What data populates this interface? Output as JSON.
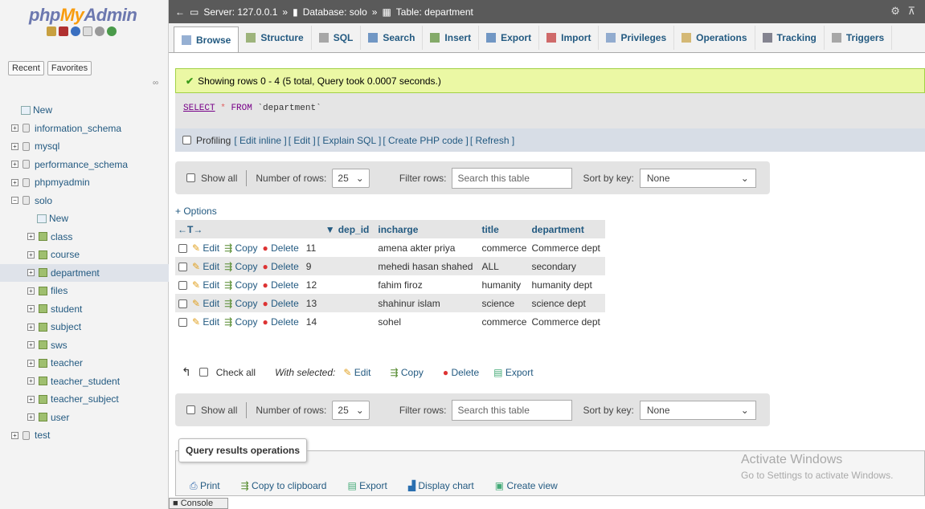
{
  "nav": {
    "logo_php": "php",
    "logo_my": "My",
    "logo_admin": "Admin",
    "recent": "Recent",
    "favorites": "Favorites",
    "tree": [
      {
        "label": "New",
        "level": 0,
        "kind": "new"
      },
      {
        "label": "information_schema",
        "level": 0,
        "kind": "db"
      },
      {
        "label": "mysql",
        "level": 0,
        "kind": "db"
      },
      {
        "label": "performance_schema",
        "level": 0,
        "kind": "db"
      },
      {
        "label": "phpmyadmin",
        "level": 0,
        "kind": "db"
      },
      {
        "label": "solo",
        "level": 0,
        "kind": "db-open"
      },
      {
        "label": "New",
        "level": 1,
        "kind": "new"
      },
      {
        "label": "class",
        "level": 1,
        "kind": "table"
      },
      {
        "label": "course",
        "level": 1,
        "kind": "table"
      },
      {
        "label": "department",
        "level": 1,
        "kind": "table",
        "selected": true
      },
      {
        "label": "files",
        "level": 1,
        "kind": "table"
      },
      {
        "label": "student",
        "level": 1,
        "kind": "table"
      },
      {
        "label": "subject",
        "level": 1,
        "kind": "table"
      },
      {
        "label": "sws",
        "level": 1,
        "kind": "table"
      },
      {
        "label": "teacher",
        "level": 1,
        "kind": "table"
      },
      {
        "label": "teacher_student",
        "level": 1,
        "kind": "table"
      },
      {
        "label": "teacher_subject",
        "level": 1,
        "kind": "table"
      },
      {
        "label": "user",
        "level": 1,
        "kind": "table"
      },
      {
        "label": "test",
        "level": 0,
        "kind": "db"
      }
    ]
  },
  "breadcrumb": {
    "server": "Server: 127.0.0.1",
    "database": "Database: solo",
    "table": "Table: department",
    "sep": "»"
  },
  "tabs": [
    {
      "label": "Browse",
      "icon": "browse-icon",
      "active": true
    },
    {
      "label": "Structure",
      "icon": "structure-icon"
    },
    {
      "label": "SQL",
      "icon": "sql-icon"
    },
    {
      "label": "Search",
      "icon": "search-icon"
    },
    {
      "label": "Insert",
      "icon": "insert-icon"
    },
    {
      "label": "Export",
      "icon": "export-icon"
    },
    {
      "label": "Import",
      "icon": "import-icon"
    },
    {
      "label": "Privileges",
      "icon": "privileges-icon"
    },
    {
      "label": "Operations",
      "icon": "operations-icon"
    },
    {
      "label": "Tracking",
      "icon": "tracking-icon"
    },
    {
      "label": "Triggers",
      "icon": "triggers-icon"
    }
  ],
  "success_msg": "Showing rows 0 - 4 (5 total, Query took 0.0007 seconds.)",
  "sql": {
    "select": "SELECT",
    "star": "*",
    "from": "FROM",
    "table": "`department`"
  },
  "profiling": {
    "label": "Profiling",
    "links": [
      "[ Edit inline ]",
      "[ Edit ]",
      "[ Explain SQL ]",
      "[ Create PHP code ]",
      "[ Refresh ]"
    ]
  },
  "nav_bar": {
    "show_all": "Show all",
    "num_rows_label": "Number of rows:",
    "num_rows_value": "25",
    "filter_label": "Filter rows:",
    "filter_placeholder": "Search this table",
    "sort_label": "Sort by key:",
    "sort_value": "None"
  },
  "options_link": "+ Options",
  "table": {
    "arrows": "←T→",
    "sort_arrow": "▼",
    "columns": [
      "dep_id",
      "incharge",
      "title",
      "department"
    ],
    "actions": {
      "edit": "Edit",
      "copy": "Copy",
      "delete": "Delete"
    },
    "rows": [
      {
        "dep_id": "11",
        "incharge": "amena akter priya",
        "title": "commerce",
        "department": "Commerce dept"
      },
      {
        "dep_id": "9",
        "incharge": "mehedi hasan shahed",
        "title": "ALL",
        "department": "secondary"
      },
      {
        "dep_id": "12",
        "incharge": "fahim firoz",
        "title": "humanity",
        "department": "humanity dept"
      },
      {
        "dep_id": "13",
        "incharge": "shahinur islam",
        "title": "science",
        "department": "science dept"
      },
      {
        "dep_id": "14",
        "incharge": "sohel",
        "title": "commerce",
        "department": "Commerce dept"
      }
    ]
  },
  "with_selected": {
    "check_all": "Check all",
    "label": "With selected:",
    "edit": "Edit",
    "copy": "Copy",
    "delete": "Delete",
    "export": "Export"
  },
  "qro": {
    "title": "Query results operations",
    "print": "Print",
    "copy_clip": "Copy to clipboard",
    "export": "Export",
    "display_chart": "Display chart",
    "create_view": "Create view"
  },
  "watermark": {
    "line1": "Activate Windows",
    "line2": "Go to Settings to activate Windows."
  },
  "console": "Console",
  "colors": {
    "accent": "#235a81",
    "success_bg": "#ebf8a4",
    "topbar": "#5a5a5a"
  }
}
